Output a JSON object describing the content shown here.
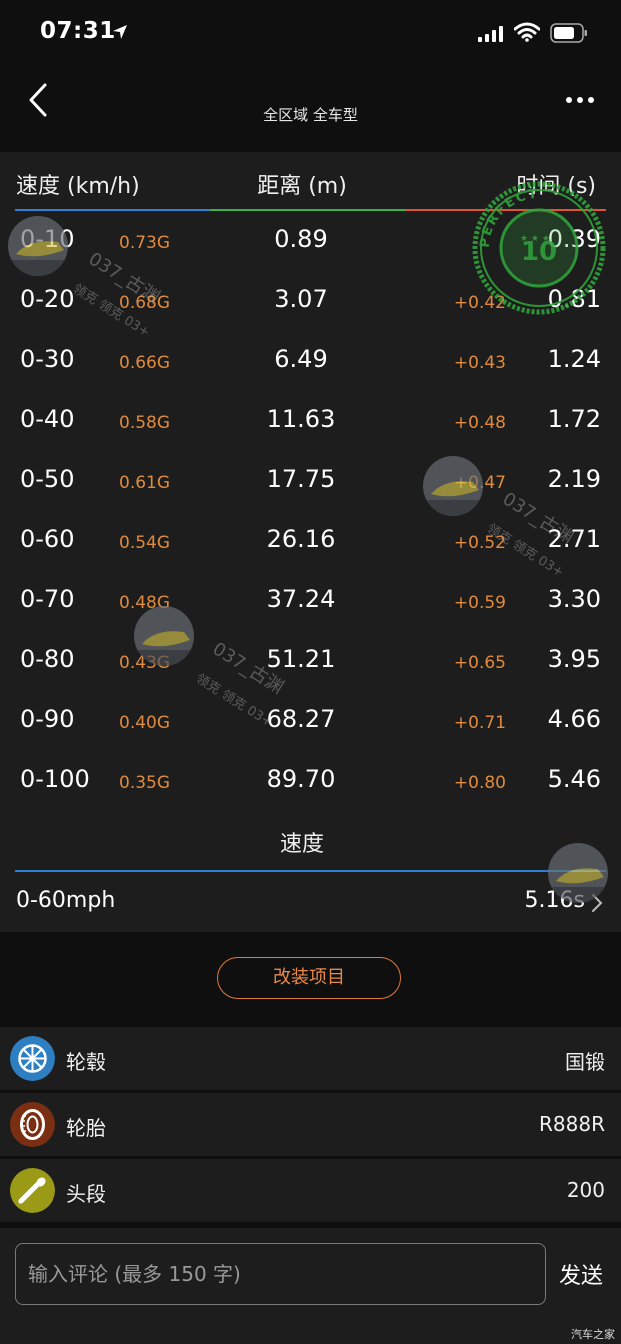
{
  "status_bar": {
    "time": "07:31"
  },
  "nav": {
    "title": "全区域 全车型"
  },
  "table": {
    "header": {
      "speed": "速度 (km/h)",
      "distance": "距离 (m)",
      "time": "时间 (s)"
    },
    "rows": [
      {
        "range": "0-10",
        "g": "0.73G",
        "distance": "0.89",
        "delta": "",
        "time": "0.39"
      },
      {
        "range": "0-20",
        "g": "0.68G",
        "distance": "3.07",
        "delta": "+0.42",
        "time": "0.81"
      },
      {
        "range": "0-30",
        "g": "0.66G",
        "distance": "6.49",
        "delta": "+0.43",
        "time": "1.24"
      },
      {
        "range": "0-40",
        "g": "0.58G",
        "distance": "11.63",
        "delta": "+0.48",
        "time": "1.72"
      },
      {
        "range": "0-50",
        "g": "0.61G",
        "distance": "17.75",
        "delta": "+0.47",
        "time": "2.19"
      },
      {
        "range": "0-60",
        "g": "0.54G",
        "distance": "26.16",
        "delta": "+0.52",
        "time": "2.71"
      },
      {
        "range": "0-70",
        "g": "0.48G",
        "distance": "37.24",
        "delta": "+0.59",
        "time": "3.30"
      },
      {
        "range": "0-80",
        "g": "0.43G",
        "distance": "51.21",
        "delta": "+0.65",
        "time": "3.95"
      },
      {
        "range": "0-90",
        "g": "0.40G",
        "distance": "68.27",
        "delta": "+0.71",
        "time": "4.66"
      },
      {
        "range": "0-100",
        "g": "0.35G",
        "distance": "89.70",
        "delta": "+0.80",
        "time": "5.46"
      }
    ],
    "speed_label": "速度",
    "mph_label": "0-60mph",
    "mph_value": "5.16s"
  },
  "mods": {
    "button_label": "改装项目",
    "items": [
      {
        "name": "轮毂",
        "value": "国锻",
        "icon": "wheel-rim-icon",
        "color": "#2d7fc1"
      },
      {
        "name": "轮胎",
        "value": "R888R",
        "icon": "tire-icon",
        "color": "#7a2e12"
      },
      {
        "name": "头段",
        "value": "200",
        "icon": "exhaust-pipe-icon",
        "color": "#9a9a16"
      }
    ]
  },
  "comment": {
    "placeholder": "输入评论 (最多 150 字)",
    "send_label": "发送"
  },
  "watermark": {
    "user": "037_古渊",
    "car": "领克 领克 03+",
    "stamp_text": "PERFECT",
    "stamp_number": "10",
    "site": "汽车之家"
  },
  "colors": {
    "accent_orange": "#e08a3c",
    "line_blue": "#2f7fd6",
    "line_green": "#37b24d",
    "line_red": "#e0552b",
    "stamp_green": "#2fa33a"
  }
}
